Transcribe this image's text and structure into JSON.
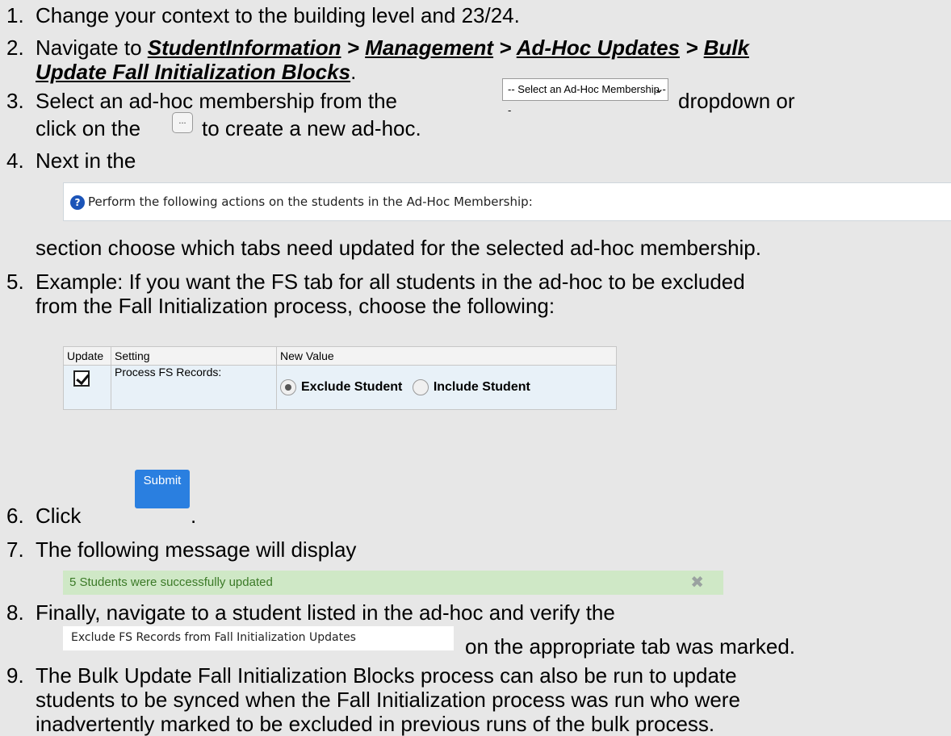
{
  "steps": [
    {
      "num": "1.",
      "text": "Change your context to the building level and 23/24."
    },
    {
      "num": "2.",
      "prefix": "Navigate to ",
      "nav": [
        "StudentInformation",
        "Management",
        "Ad-Hoc Updates",
        "Bulk",
        "Update Fall Initialization Blocks"
      ],
      "sep": " > ",
      "suffix": "."
    },
    {
      "num": "3.",
      "a": "Select an ad-hoc membership from the",
      "b": "dropdown or",
      "c": "click on the",
      "d": "to create a new ad-hoc."
    },
    {
      "num": "4.",
      "a": "Next in the",
      "b": "section choose which tabs need updated for the selected ad-hoc membership."
    },
    {
      "num": "5.",
      "a": "Example: If you want the FS tab for all students in the ad-hoc to be excluded",
      "b": "from the Fall Initialization process, choose the following:"
    },
    {
      "num": "6.",
      "a": "Click",
      "b": "."
    },
    {
      "num": "7.",
      "a": "The following message will display"
    },
    {
      "num": "8.",
      "a": "Finally, navigate to a student listed in the ad-hoc and verify the",
      "b": "on the appropriate tab was marked."
    },
    {
      "num": "9.",
      "a": "The Bulk Update Fall Initialization Blocks process can also be run to update",
      "b": "students to be synced when the Fall Initialization process was run who were",
      "c": "inadvertently marked to be excluded in previous runs of the bulk process."
    }
  ],
  "ui": {
    "select_placeholder": "-- Select an Ad-Hoc Membership --",
    "ellipsis": "...",
    "perform_text": "Perform the following actions on the students in the Ad-Hoc Membership:",
    "table": {
      "headers": [
        "Update",
        "Setting",
        "New Value"
      ],
      "setting": "Process FS Records:",
      "opt_exclude": "Exclude Student",
      "opt_include": "Include Student"
    },
    "submit_label": "Submit",
    "success_message": "5 Students were successfully updated",
    "exclude_label": "Exclude FS Records from Fall Initialization Updates"
  }
}
